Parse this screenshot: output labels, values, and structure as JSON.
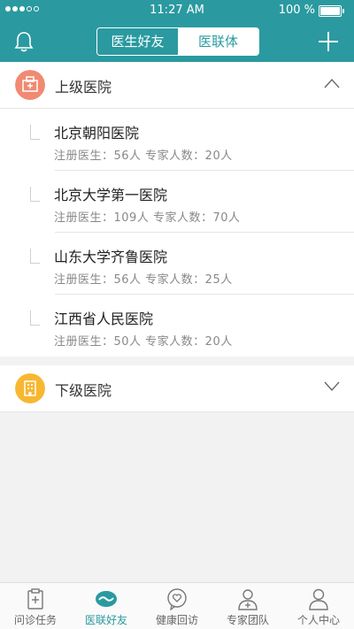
{
  "status": {
    "time": "11:27 AM",
    "battery": "100 %"
  },
  "header": {
    "tabs": [
      {
        "label": "医生好友",
        "active": true
      },
      {
        "label": "医联体",
        "active": false
      }
    ]
  },
  "upper": {
    "title": "上级医院",
    "hospitals": [
      {
        "name": "北京朝阳医院",
        "meta": "注册医生：56人   专家人数：20人"
      },
      {
        "name": "北京大学第一医院",
        "meta": "注册医生：109人   专家人数：70人"
      },
      {
        "name": "山东大学齐鲁医院",
        "meta": "注册医生：56人   专家人数：25人"
      },
      {
        "name": "江西省人民医院",
        "meta": "注册医生：50人   专家人数：20人"
      }
    ]
  },
  "lower": {
    "title": "下级医院"
  },
  "tabbar": [
    {
      "label": "问诊任务",
      "icon": "clipboard-icon"
    },
    {
      "label": "医联好友",
      "icon": "handshake-icon",
      "active": true
    },
    {
      "label": "健康回访",
      "icon": "heart-chat-icon"
    },
    {
      "label": "专家团队",
      "icon": "doctor-icon"
    },
    {
      "label": "个人中心",
      "icon": "person-icon"
    }
  ],
  "colors": {
    "primary": "#2a9aa0",
    "upper_icon": "#f08a72",
    "lower_icon": "#f7b731"
  }
}
